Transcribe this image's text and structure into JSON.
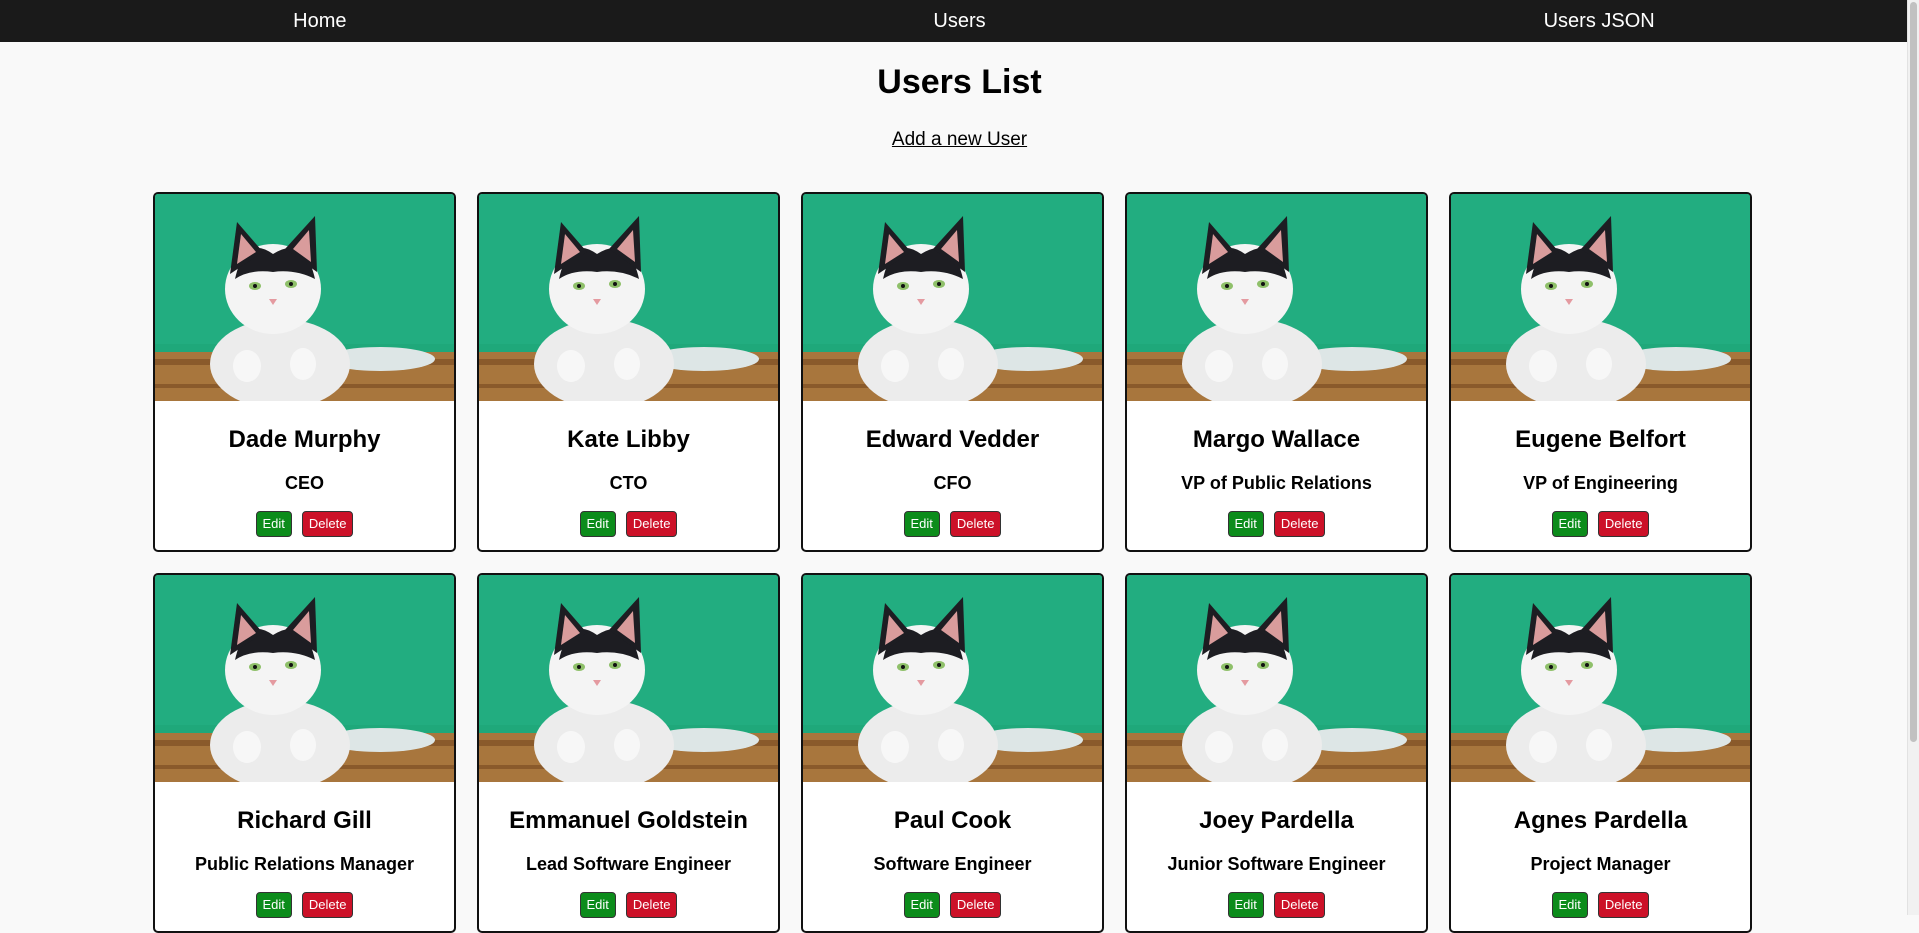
{
  "nav": {
    "items": [
      {
        "label": "Home"
      },
      {
        "label": "Users"
      },
      {
        "label": "Users JSON"
      }
    ]
  },
  "page": {
    "title": "Users List",
    "add_link": "Add a new User"
  },
  "card_image_icon": "cat-photo",
  "colors": {
    "nav_bg": "#1a1a1a",
    "edit_button": "#0c8c1b",
    "delete_button": "#cc1128",
    "photo_bg": "#1fa87a"
  },
  "users": [
    {
      "name": "Dade Murphy",
      "title": "CEO",
      "edit_label": "Edit",
      "delete_label": "Delete"
    },
    {
      "name": "Kate Libby",
      "title": "CTO",
      "edit_label": "Edit",
      "delete_label": "Delete"
    },
    {
      "name": "Edward Vedder",
      "title": "CFO",
      "edit_label": "Edit",
      "delete_label": "Delete"
    },
    {
      "name": "Margo Wallace",
      "title": "VP of Public Relations",
      "edit_label": "Edit",
      "delete_label": "Delete"
    },
    {
      "name": "Eugene Belfort",
      "title": "VP of Engineering",
      "edit_label": "Edit",
      "delete_label": "Delete"
    },
    {
      "name": "Richard Gill",
      "title": "Public Relations Manager",
      "edit_label": "Edit",
      "delete_label": "Delete"
    },
    {
      "name": "Emmanuel Goldstein",
      "title": "Lead Software Engineer",
      "edit_label": "Edit",
      "delete_label": "Delete"
    },
    {
      "name": "Paul Cook",
      "title": "Software Engineer",
      "edit_label": "Edit",
      "delete_label": "Delete"
    },
    {
      "name": "Joey Pardella",
      "title": "Junior Software Engineer",
      "edit_label": "Edit",
      "delete_label": "Delete"
    },
    {
      "name": "Agnes Pardella",
      "title": "Project Manager",
      "edit_label": "Edit",
      "delete_label": "Delete"
    }
  ]
}
